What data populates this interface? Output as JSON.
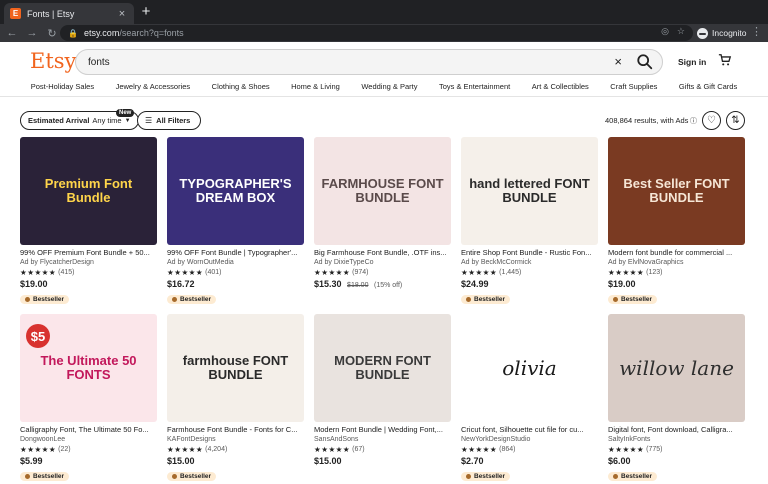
{
  "browser": {
    "tab_title": "Fonts | Etsy",
    "url_host": "etsy.com",
    "url_path": "/search?q=fonts",
    "profile_label": "Incognito"
  },
  "header": {
    "logo": "Etsy",
    "search_value": "fonts",
    "signin": "Sign in"
  },
  "categories": [
    "Post-Holiday Sales",
    "Jewelry & Accessories",
    "Clothing & Shoes",
    "Home & Living",
    "Wedding & Party",
    "Toys & Entertainment",
    "Art & Collectibles",
    "Craft Supplies",
    "Gifts & Gift Cards"
  ],
  "filters": {
    "arrival_label": "Estimated Arrival",
    "arrival_value": "Any time",
    "new_badge": "New",
    "all_filters": "All Filters",
    "results": "408,864 results, with Ads"
  },
  "products": [
    {
      "title": "99% OFF Premium Font Bundle + 50...",
      "shop": "Ad by FlycatcherDesign",
      "rating_count": "(415)",
      "price": "$19.00",
      "badge": "Bestseller",
      "thumb_text": "Premium Font Bundle",
      "thumb_bg": "#2a2238",
      "thumb_fg": "#ffd54a"
    },
    {
      "title": "99% OFF Font Bundle | Typographer'...",
      "shop": "Ad by WornOutMedia",
      "rating_count": "(401)",
      "price": "$16.72",
      "badge": "Bestseller",
      "thumb_text": "TYPOGRAPHER'S DREAM BOX",
      "thumb_bg": "#3a2f7a",
      "thumb_fg": "#ffffff"
    },
    {
      "title": "Big Farmhouse Font Bundle, .OTF ins...",
      "shop": "Ad by DixieTypeCo",
      "rating_count": "(974)",
      "price": "$15.30",
      "orig_price": "$18.00",
      "discount": "(15% off)",
      "thumb_text": "FARMHOUSE FONT BUNDLE",
      "thumb_bg": "#f3e4e4",
      "thumb_fg": "#5a4a4a"
    },
    {
      "title": "Entire Shop Font Bundle - Rustic Fon...",
      "shop": "Ad by BeckMcCormick",
      "rating_count": "(1,445)",
      "price": "$24.99",
      "badge": "Bestseller",
      "thumb_text": "hand lettered FONT BUNDLE",
      "thumb_bg": "#f5f0ea",
      "thumb_fg": "#2b2b2b"
    },
    {
      "title": "Modern font bundle for commercial ...",
      "shop": "Ad by ElvlNovaGraphics",
      "rating_count": "(123)",
      "price": "$19.00",
      "badge": "Bestseller",
      "thumb_text": "Best Seller FONT BUNDLE",
      "thumb_bg": "#7a3a22",
      "thumb_fg": "#f6e6d6"
    },
    {
      "title": "Calligraphy Font, The Ultimate 50 Fo...",
      "shop": "DongwoonLee",
      "rating_count": "(22)",
      "price": "$5.99",
      "badge": "Bestseller",
      "sale_tag": "$5",
      "thumb_text": "The Ultimate 50 FONTS",
      "thumb_bg": "#fbe6ea",
      "thumb_fg": "#c2185b"
    },
    {
      "title": "Farmhouse Font Bundle - Fonts for C...",
      "shop": "KAFontDesigns",
      "rating_count": "(4,204)",
      "price": "$15.00",
      "badge": "Bestseller",
      "thumb_text": "farmhouse FONT BUNDLE",
      "thumb_bg": "#f4efe9",
      "thumb_fg": "#2a2a2a"
    },
    {
      "title": "Modern Font Bundle | Wedding Font,...",
      "shop": "SansAndSons",
      "rating_count": "(67)",
      "price": "$15.00",
      "thumb_text": "MODERN FONT BUNDLE",
      "thumb_bg": "#e9e3df",
      "thumb_fg": "#3a3a3a"
    },
    {
      "title": "Cricut font, Silhouette cut file for cu...",
      "shop": "NewYorkDesignStudio",
      "rating_count": "(864)",
      "price": "$2.70",
      "badge": "Bestseller",
      "thumb_text": "olivia",
      "thumb_bg": "#ffffff",
      "thumb_fg": "#1a1a1a"
    },
    {
      "title": "Digital font, Font download, Calligra...",
      "shop": "SaltyInkFonts",
      "rating_count": "(775)",
      "price": "$6.00",
      "badge": "Bestseller",
      "thumb_text": "willow lane",
      "thumb_bg": "#d9ccc6",
      "thumb_fg": "#2e2e2e"
    }
  ]
}
